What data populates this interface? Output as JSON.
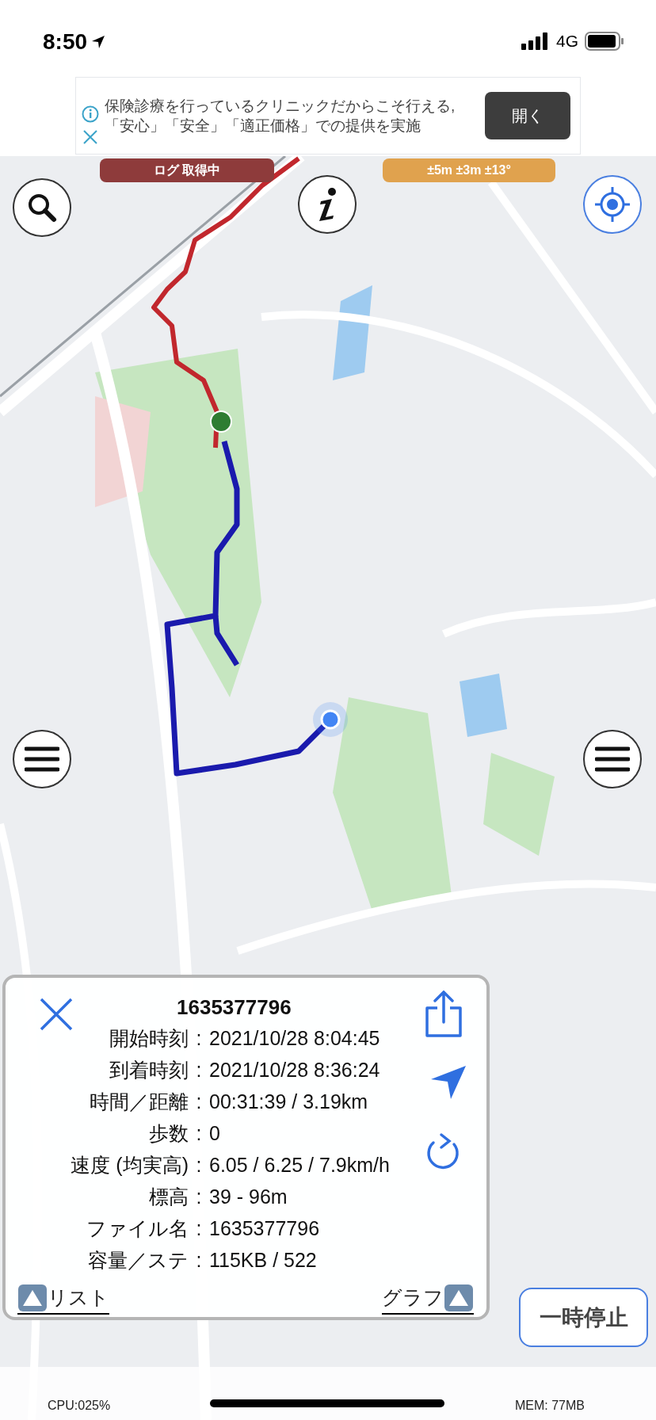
{
  "status_bar": {
    "time": "8:50",
    "network": "4G"
  },
  "ad": {
    "text": "保険診療を行っているクリニックだからこそ行える,「安心」「安全」「適正価格」での提供を実施",
    "button": "開く"
  },
  "log_status": "ログ 取得中",
  "accuracy": "±5m ±3m ±13°",
  "track": {
    "title": "1635377796",
    "rows": [
      {
        "label": "開始時刻",
        "separator": ":",
        "value": "2021/10/28 8:04:45"
      },
      {
        "label": "到着時刻",
        "separator": ":",
        "value": "2021/10/28 8:36:24"
      },
      {
        "label": "時間／距離",
        "separator": ":",
        "value": "00:31:39 / 3.19km"
      },
      {
        "label": "歩数",
        "separator": ":",
        "value": "0"
      },
      {
        "label": "速度 (均実高)",
        "separator": ":",
        "value": "6.05 / 6.25 / 7.9km/h"
      },
      {
        "label": "標高",
        "separator": ":",
        "value": "39 - 96m"
      },
      {
        "label": "ファイル名",
        "separator": ":",
        "value": "1635377796"
      },
      {
        "label": "容量／ステ",
        "separator": ":",
        "value": "115KB / 522"
      }
    ],
    "list_link": "リスト",
    "graph_link": "グラフ"
  },
  "pause_button": "一時停止",
  "footer": {
    "cpu": "CPU:025%",
    "memory": "MEM: 77MB"
  }
}
